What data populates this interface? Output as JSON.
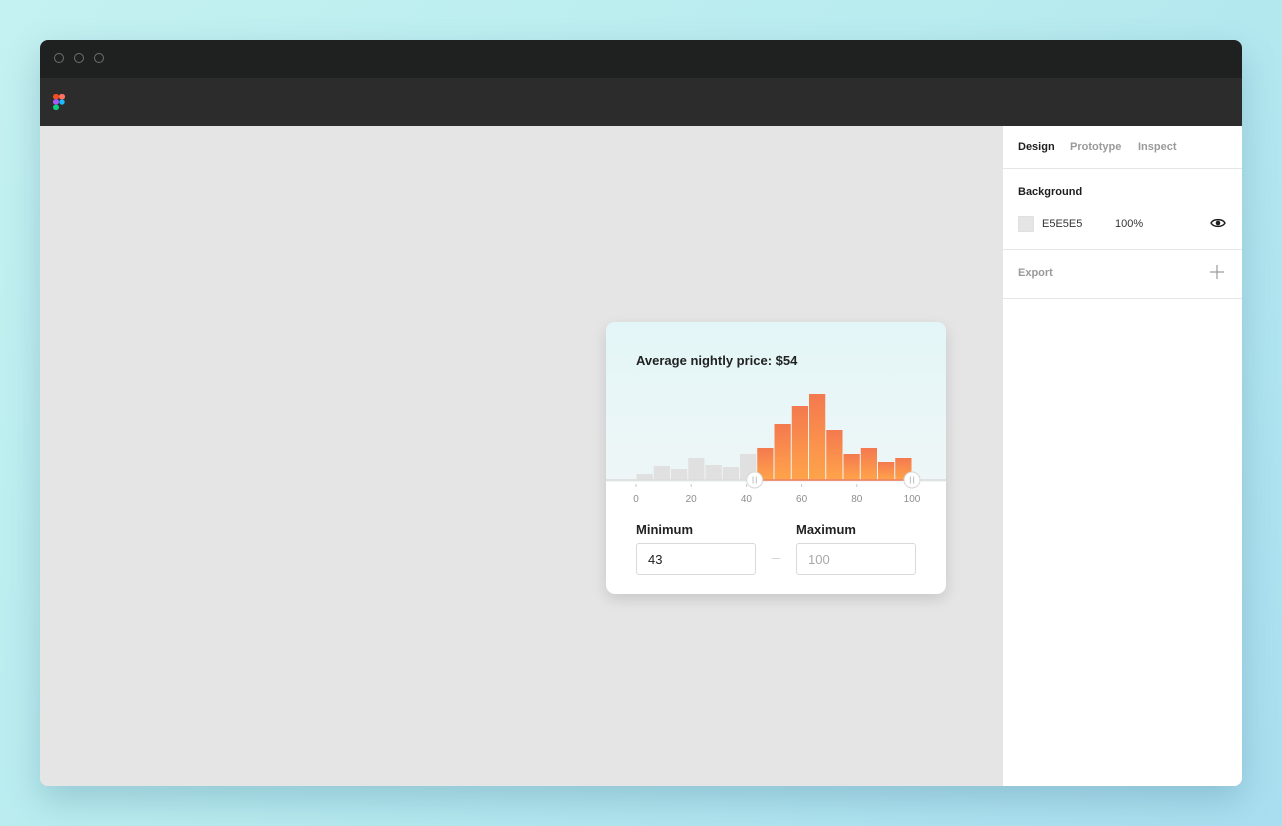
{
  "panel": {
    "tabs": [
      {
        "label": "Design",
        "active": true
      },
      {
        "label": "Prototype",
        "active": false
      },
      {
        "label": "Inspect",
        "active": false
      }
    ],
    "background": {
      "title": "Background",
      "hex": "E5E5E5",
      "opacity": "100%",
      "swatch_color": "#E5E5E5",
      "visibility_icon": "eye-icon"
    },
    "export": {
      "title": "Export",
      "add_icon": "plus-icon"
    }
  },
  "toolbar": {
    "logo_icon": "figma-logo-icon"
  },
  "card": {
    "title": "Average nightly price: $54",
    "minimum": {
      "label": "Minimum",
      "value": "43"
    },
    "maximum": {
      "label": "Maximum",
      "placeholder": "100"
    }
  },
  "chart_data": {
    "type": "bar",
    "x_ticks": [
      0,
      20,
      40,
      60,
      80,
      100
    ],
    "x_range": [
      0,
      100
    ],
    "bin_width": 6.25,
    "values": [
      6,
      14,
      11,
      22,
      15,
      13,
      26,
      32,
      56,
      74,
      86,
      50,
      26,
      32,
      18,
      22
    ],
    "selected_range": [
      43,
      100
    ],
    "colors": {
      "selected_top": "#F4794F",
      "selected_bottom": "#FFA44A",
      "unselected": "#E0E0E0"
    }
  }
}
